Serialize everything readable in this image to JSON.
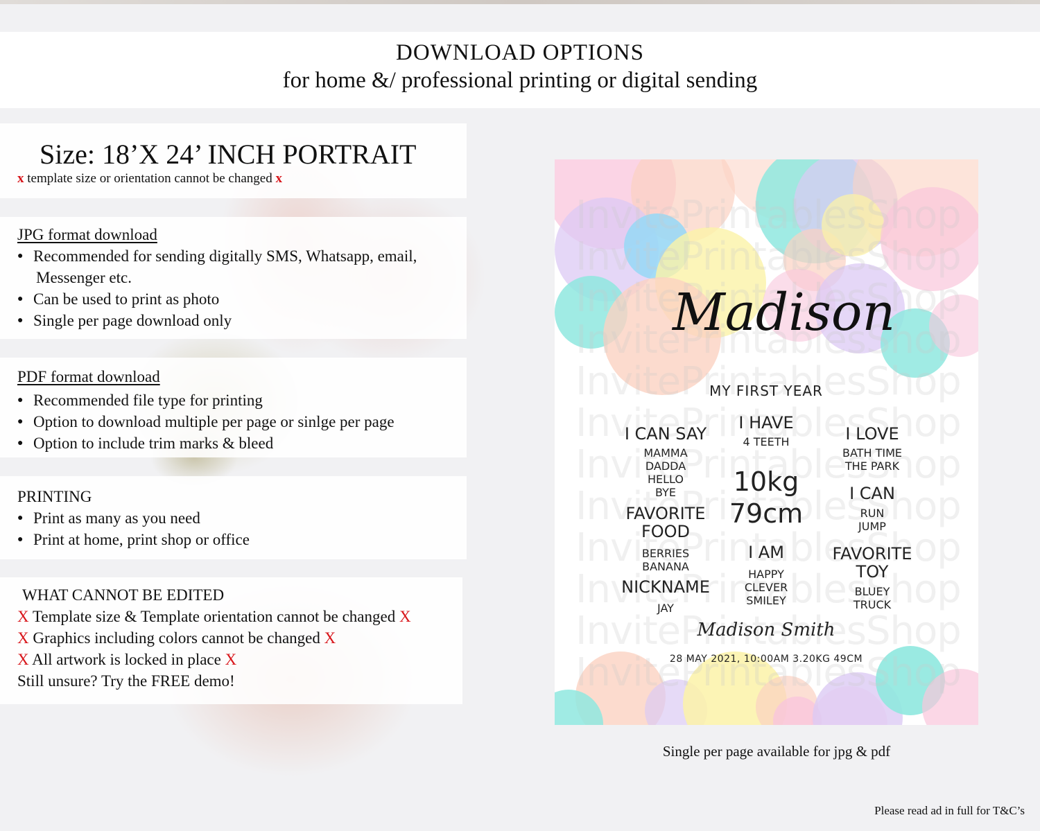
{
  "header": {
    "title": "DOWNLOAD OPTIONS",
    "subtitle": "for home &/ professional printing or digital sending"
  },
  "size": {
    "title": "Size: 18’X 24’ INCH PORTRAIT",
    "note": "template size or orientation cannot be changed",
    "x_mark": "x"
  },
  "jpg": {
    "heading": "JPG format download",
    "bullets": [
      "Recommended for sending digitally SMS, Whatsapp, email,",
      "Can be used to print as photo",
      "Single per page download only"
    ],
    "continuation": "Messenger etc."
  },
  "pdf": {
    "heading": "PDF format download",
    "bullets": [
      "Recommended file type for printing",
      "Option to download multiple per page or sinlge per page",
      "Option to include trim marks & bleed"
    ]
  },
  "printing": {
    "heading": "PRINTING",
    "bullets": [
      "Print as many as you need",
      "Print at home, print shop or office"
    ]
  },
  "cannot_edit": {
    "heading": "WHAT CANNOT BE EDITED",
    "x_mark": "X",
    "items": [
      "Template size & Template orientation cannot be changed",
      "Graphics including colors cannot be changed",
      "All artwork is locked in place"
    ],
    "demo": "Still unsure? Try the FREE demo!"
  },
  "poster": {
    "watermark": "InvitePrintablesShop",
    "name": "Madison",
    "subtitle": "MY FIRST YEAR",
    "i_can_say": {
      "heading": "I CAN SAY",
      "items": [
        "MAMMA",
        "DADDA",
        "HELLO",
        "BYE"
      ]
    },
    "i_have": {
      "heading": "I HAVE",
      "value": "4 TEETH"
    },
    "weight": "10kg",
    "height": "79cm",
    "i_love": {
      "heading": "I LOVE",
      "items": [
        "BATH TIME",
        "THE PARK"
      ]
    },
    "i_can": {
      "heading": "I CAN",
      "items": [
        "RUN",
        "JUMP"
      ]
    },
    "favorite_food": {
      "heading1": "FAVORITE",
      "heading2": "FOOD",
      "items": [
        "BERRIES",
        "BANANA"
      ]
    },
    "i_am": {
      "heading": "I AM",
      "items": [
        "HAPPY",
        "CLEVER",
        "SMILEY"
      ]
    },
    "favorite_toy": {
      "heading1": "FAVORITE",
      "heading2": "TOY",
      "items": [
        "BLUEY",
        "TRUCK"
      ]
    },
    "nickname": {
      "heading": "NICKNAME",
      "value": "JAY"
    },
    "signature": "Madison Smith",
    "birth_details": "28 MAY 2021, 10:00AM 3.20KG 49CM",
    "colors": {
      "pink": "#f9c6dc",
      "peach": "#fbd2c2",
      "mint": "#8fe8df",
      "lavender": "#dccaf4",
      "yellow": "#fbf2a8",
      "blue": "#9ad8f5"
    }
  },
  "caption": "Single per page available for jpg & pdf",
  "footer_note": "Please read ad in full for T&C’s"
}
